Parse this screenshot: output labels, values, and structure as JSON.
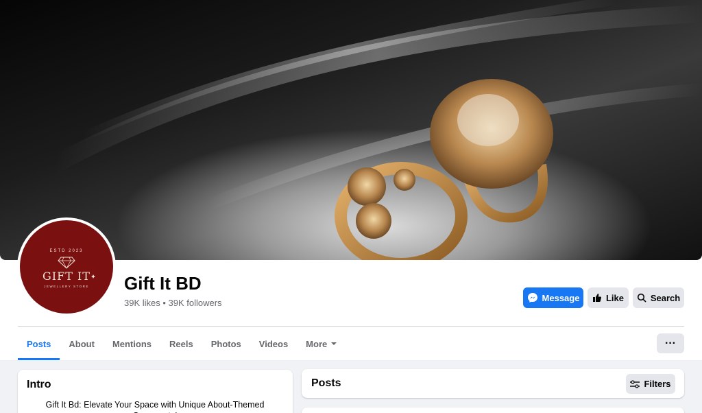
{
  "page": {
    "name": "Gift It BD",
    "meta": "39K likes • 39K followers"
  },
  "logo": {
    "est": "ESTD 2023",
    "name": "GIFT IT",
    "sub": "JEWELLERY STORE"
  },
  "actions": {
    "message": "Message",
    "like": "Like",
    "search": "Search",
    "more": "···"
  },
  "tabs": [
    {
      "label": "Posts"
    },
    {
      "label": "About"
    },
    {
      "label": "Mentions"
    },
    {
      "label": "Reels"
    },
    {
      "label": "Photos"
    },
    {
      "label": "Videos"
    },
    {
      "label": "More"
    }
  ],
  "intro": {
    "title": "Intro",
    "text": "Gift It Bd: Elevate Your Space with Unique About-Themed Ornaments!"
  },
  "posts": {
    "title": "Posts",
    "filters": "Filters"
  },
  "colors": {
    "accent": "#1877f2",
    "logo_bg": "#7a1010"
  }
}
